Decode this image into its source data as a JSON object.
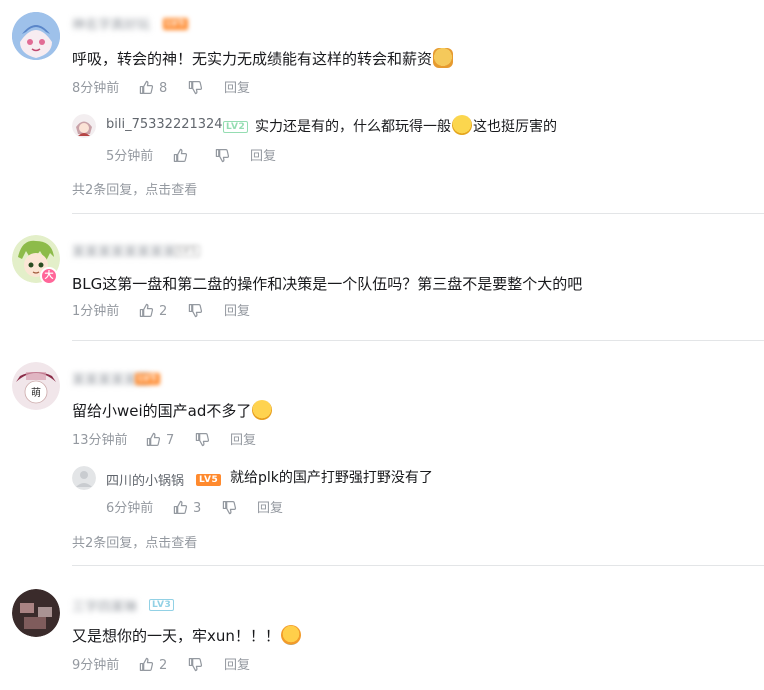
{
  "comments": [
    {
      "username": "神名字真好玩",
      "level": "LV5",
      "content": "呼吸，转会的神！无实力无成绩能有这样的转会和薪资",
      "time": "8分钟前",
      "likes": "8",
      "reply_label": "回复",
      "replies": [
        {
          "username": "bili_75332221324",
          "level": "LV2",
          "content_before": "实力还是有的，什么都玩得一般",
          "content_after": "这也挺厉害的",
          "time": "5分钟前",
          "likes": "",
          "reply_label": "回复"
        }
      ],
      "view_more": "共2条回复，点击查看"
    },
    {
      "username": "某某某某某某某某",
      "level": "LV1",
      "content": "BLG这第一盘和第二盘的操作和决策是一个队伍吗？第三盘不是要整个大的吧",
      "time": "1分钟前",
      "likes": "2",
      "reply_label": "回复"
    },
    {
      "username": "某某某某某某",
      "level": "LV5",
      "content": "留给小wei的国产ad不多了",
      "time": "13分钟前",
      "likes": "7",
      "reply_label": "回复",
      "replies": [
        {
          "username": "四川的小锅锅",
          "level": "LV5",
          "content": "就给plk的国产打野强打野没有了",
          "time": "6分钟前",
          "likes": "3",
          "reply_label": "回复"
        }
      ],
      "view_more": "共2条回复，点击查看"
    },
    {
      "username": "三字四某琳",
      "level": "LV3",
      "content": "又是想你的一天，牢xun！！！",
      "time": "9分钟前",
      "likes": "2",
      "reply_label": "回复"
    }
  ],
  "icons": {
    "like": "thumbs-up-icon",
    "dislike": "thumbs-down-icon"
  },
  "colors": {
    "meta_text": "#9499a0",
    "divider": "#e3e5e7",
    "lv2": "#95ddb2",
    "lv3": "#92d1e5",
    "lv5": "#ff8a2e"
  }
}
